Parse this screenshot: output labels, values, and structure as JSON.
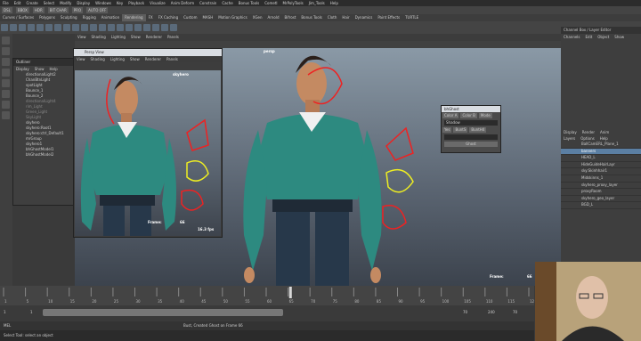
{
  "menubar": [
    "File",
    "Edit",
    "Create",
    "Select",
    "Modify",
    "Display",
    "Windows",
    "Key",
    "Playback",
    "Visualize",
    "Anim Deform",
    "Constrain",
    "Cache",
    "Bonus Tools",
    "Cometl",
    "MrPolyTools",
    "Jim_Tools",
    "Help"
  ],
  "shelf_tabs": [
    "Curves / Surfaces",
    "Polygons",
    "Sculpting",
    "Rigging",
    "Animation",
    "Rendering",
    "FX",
    "FX Caching",
    "Custom",
    "MASH",
    "Motion Graphics",
    "XGen",
    "Arnold",
    "Bifrost",
    "Bonus Tools",
    "Cloth",
    "Hair",
    "Dynamics",
    "Paint Effects",
    "TURTLE"
  ],
  "shelf_buttons": [
    "DSL",
    "BBOX",
    "HDR",
    "BIT CHAR",
    "PRO",
    "AUTO OFF"
  ],
  "viewport": {
    "menu": [
      "View",
      "Shading",
      "Lighting",
      "Show",
      "Renderer",
      "Panels"
    ],
    "cam_label": "persp",
    "frame_label": "Frame:",
    "frame_value": "66"
  },
  "outliner": {
    "title": "Outliner",
    "menu": [
      "Display",
      "Show",
      "Help"
    ],
    "items": [
      {
        "label": "directionalLight2",
        "dim": false
      },
      {
        "label": "ChanBtnLight",
        "dim": false
      },
      {
        "label": "spotLight",
        "dim": false
      },
      {
        "label": "Bounce_1",
        "dim": false
      },
      {
        "label": "Bounce_2",
        "dim": false
      },
      {
        "label": "directionalLight4",
        "dim": true
      },
      {
        "label": "rim_Light",
        "dim": true
      },
      {
        "label": "Green_Light",
        "dim": true
      },
      {
        "label": "SkyLight",
        "dim": true
      },
      {
        "label": "skyhero",
        "dim": false
      },
      {
        "label": "skyhero:Root1",
        "dim": false
      },
      {
        "label": "skyhero:ctrl_Default1",
        "dim": false
      },
      {
        "label": "mrGroup",
        "dim": false
      },
      {
        "label": "skyhero1",
        "dim": false
      },
      {
        "label": "bhGhostModel1",
        "dim": false
      },
      {
        "label": "bhGhostModel2",
        "dim": false
      }
    ]
  },
  "persp_window": {
    "title": "Persp View",
    "menu": [
      "View",
      "Shading",
      "Lighting",
      "Show",
      "Renderer",
      "Panels"
    ],
    "fps": "16.3 fps",
    "frame_label": "Frame:",
    "frame_value": "66",
    "cam_label": "skyhero"
  },
  "ghost_panel": {
    "title": "bhGhost",
    "tabs": [
      "Color A",
      "Color B",
      "Mode"
    ],
    "shadow_label": "Shadow",
    "buttons": [
      "Yes",
      "BuntS",
      "BuntH4"
    ],
    "ghost_button": "Ghost"
  },
  "channelbox": {
    "title": "Channel Box / Layer Editor",
    "menu": [
      "Channels",
      "Edit",
      "Object",
      "Show"
    ],
    "layer_tabs": [
      "Display",
      "Render",
      "Anim"
    ],
    "layer_menu": [
      "Layers",
      "Options",
      "Help"
    ],
    "layers": [
      {
        "label": "BallCamERL_Plane_1",
        "sel": false
      },
      {
        "label": "banners",
        "sel": true
      },
      {
        "label": "HEAD_L",
        "sel": false
      },
      {
        "label": "HideGuideHairLayr",
        "sel": false
      },
      {
        "label": "sky:Skinhhair1",
        "sel": false
      },
      {
        "label": "Midskinns_1",
        "sel": false
      },
      {
        "label": "skyhero_proxy_layer",
        "sel": false
      },
      {
        "label": "proxyRoom",
        "sel": false
      },
      {
        "label": "skyhero_geo_layer",
        "sel": false
      },
      {
        "label": "BGD_L",
        "sel": false
      }
    ]
  },
  "timeline": {
    "ticks": [
      "1",
      "5",
      "10",
      "15",
      "20",
      "25",
      "30",
      "35",
      "40",
      "45",
      "50",
      "55",
      "60",
      "65",
      "70",
      "75",
      "80",
      "85",
      "90",
      "95",
      "100",
      "105",
      "110",
      "115",
      "120"
    ],
    "current": "66"
  },
  "range": {
    "start": "1",
    "inner_start": "1",
    "inner_end": "70",
    "end": "240",
    "anim_start": "1",
    "anim_end": "70"
  },
  "cmdline": {
    "label": "MEL",
    "feedback": "Bust, Created Ghost on Frame 66"
  },
  "helpline": "Select Tool: select an object"
}
